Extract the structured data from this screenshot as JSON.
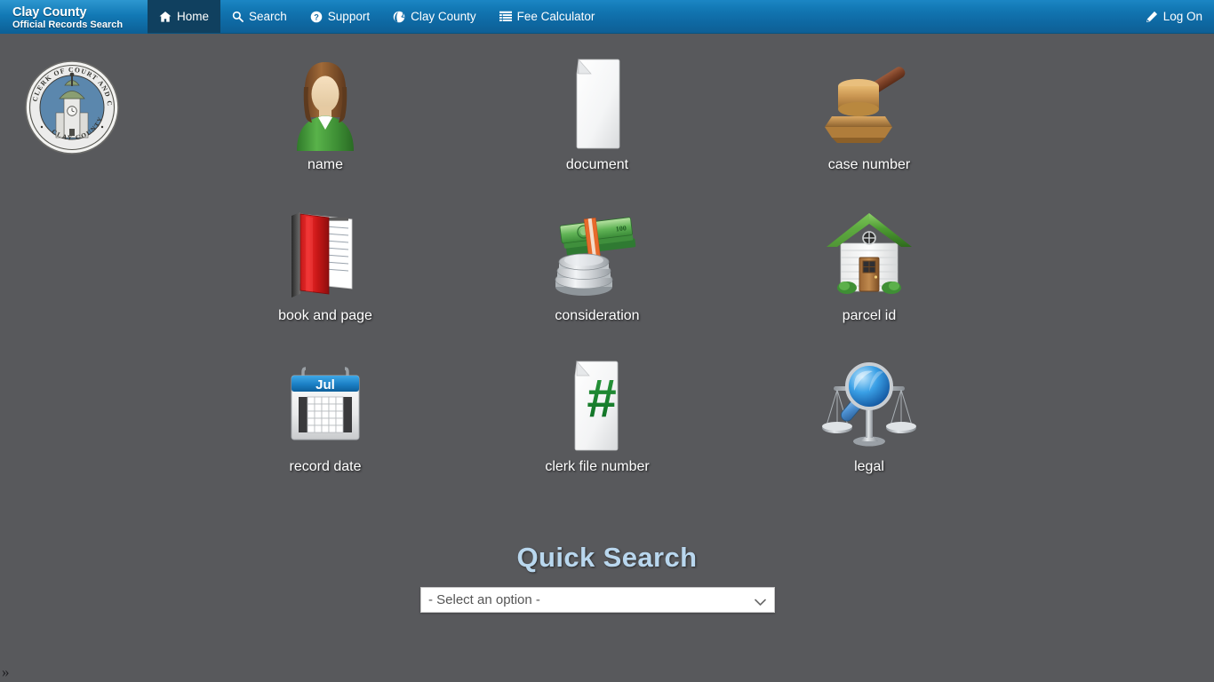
{
  "navbar": {
    "brand": {
      "line1": "Clay County",
      "line2": "Official Records Search"
    },
    "items": [
      {
        "label": "Home",
        "icon": "home-icon",
        "active": true
      },
      {
        "label": "Search",
        "icon": "search-icon",
        "active": false
      },
      {
        "label": "Support",
        "icon": "question-circle-icon",
        "active": false
      },
      {
        "label": "Clay County",
        "icon": "globe-icon",
        "active": false
      },
      {
        "label": "Fee Calculator",
        "icon": "list-icon",
        "active": false
      }
    ],
    "right": {
      "label": "Log On",
      "icon": "pencil-icon"
    },
    "colors": {
      "background_top": "#1b86c4",
      "background_bottom": "#0d5f95",
      "active_tab": "#10405f"
    }
  },
  "seal": {
    "name": "clay-county-clerk-seal",
    "text_top": "CLERK OF COURT   AND COMPTROLLER",
    "text_bottom": "CLAY COUNTY"
  },
  "search_options": [
    {
      "label": "name",
      "icon": "person-icon"
    },
    {
      "label": "document",
      "icon": "document-icon"
    },
    {
      "label": "case number",
      "icon": "gavel-icon"
    },
    {
      "label": "book and page",
      "icon": "red-book-icon"
    },
    {
      "label": "consideration",
      "icon": "money-icon"
    },
    {
      "label": "parcel id",
      "icon": "house-icon"
    },
    {
      "label": "record date",
      "icon": "calendar-icon"
    },
    {
      "label": "clerk file number",
      "icon": "hash-document-icon"
    },
    {
      "label": "legal",
      "icon": "scales-magnifier-icon"
    }
  ],
  "quick_search": {
    "title": "Quick Search",
    "select_value": "- Select an option -",
    "options": [
      "- Select an option -"
    ]
  },
  "footer": {
    "expand_chevron": "»"
  },
  "page": {
    "background_color": "#58595c",
    "title_color": "#b9d7ee"
  }
}
